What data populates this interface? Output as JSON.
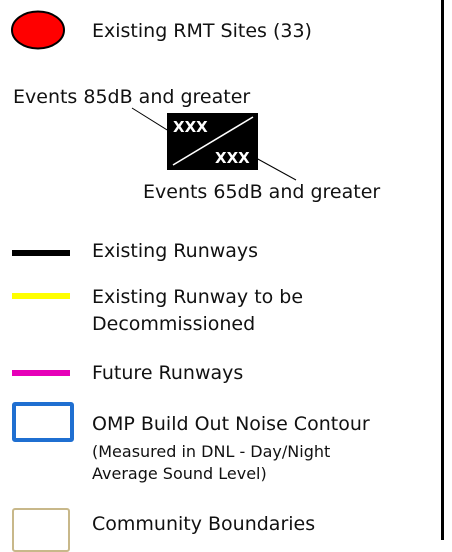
{
  "legend": {
    "rmt_sites": {
      "label": "Existing RMT Sites (33)",
      "icon": "red-circle-icon",
      "color": "#ff0000"
    },
    "event_callout": {
      "top_label": "Events 85dB and greater",
      "bottom_label": "Events 65dB and greater",
      "top_value": "XXX",
      "bottom_value": "XXX"
    },
    "runway_existing": {
      "label": "Existing Runways",
      "color": "#000000"
    },
    "runway_decommissioned": {
      "label_line1": "Existing Runway to be",
      "label_line2": "Decommissioned",
      "color": "#ffff00"
    },
    "runway_future": {
      "label": "Future Runways",
      "color": "#e600b8"
    },
    "noise_contour": {
      "label": "OMP Build Out Noise Contour",
      "sub_line1": "(Measured in DNL - Day/Night",
      "sub_line2": "Average Sound Level)",
      "color": "#1f6fd1"
    },
    "community_boundaries": {
      "label": "Community Boundaries",
      "color": "#c8b88a"
    }
  }
}
